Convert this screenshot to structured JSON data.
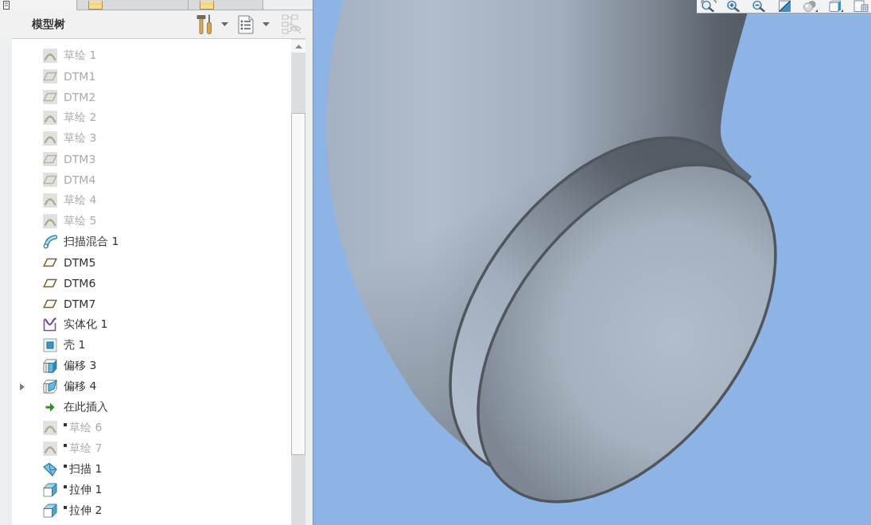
{
  "panel_tabs": [
    {
      "kind": "tree",
      "selected": true
    },
    {
      "kind": "folder",
      "selected": false
    },
    {
      "kind": "folder",
      "selected": false
    }
  ],
  "model_tree": {
    "title": "模型树",
    "toolbar": [
      {
        "kind": "tools",
        "dropdown": true,
        "disabled": false
      },
      {
        "kind": "display",
        "dropdown": true,
        "disabled": false
      },
      {
        "kind": "filter",
        "dropdown": false,
        "disabled": true
      }
    ],
    "items": [
      {
        "label": "草绘 1",
        "kind": "sketch",
        "hidden": true,
        "after_insert": false
      },
      {
        "label": "DTM1",
        "kind": "plane",
        "hidden": true,
        "after_insert": false
      },
      {
        "label": "DTM2",
        "kind": "plane",
        "hidden": true,
        "after_insert": false
      },
      {
        "label": "草绘 2",
        "kind": "sketch",
        "hidden": true,
        "after_insert": false
      },
      {
        "label": "草绘 3",
        "kind": "sketch",
        "hidden": true,
        "after_insert": false
      },
      {
        "label": "DTM3",
        "kind": "plane",
        "hidden": true,
        "after_insert": false
      },
      {
        "label": "DTM4",
        "kind": "plane",
        "hidden": true,
        "after_insert": false
      },
      {
        "label": "草绘 4",
        "kind": "sketch",
        "hidden": true,
        "after_insert": false
      },
      {
        "label": "草绘 5",
        "kind": "sketch",
        "hidden": true,
        "after_insert": false
      },
      {
        "label": "扫描混合 1",
        "kind": "sweep_blend",
        "hidden": false,
        "after_insert": false
      },
      {
        "label": "DTM5",
        "kind": "plane",
        "hidden": false,
        "after_insert": false
      },
      {
        "label": "DTM6",
        "kind": "plane",
        "hidden": false,
        "after_insert": false
      },
      {
        "label": "DTM7",
        "kind": "plane",
        "hidden": false,
        "after_insert": false
      },
      {
        "label": "实体化 1",
        "kind": "solidify",
        "hidden": false,
        "after_insert": false
      },
      {
        "label": "壳 1",
        "kind": "shell",
        "hidden": false,
        "after_insert": false
      },
      {
        "label": "偏移 3",
        "kind": "offset_solid",
        "hidden": false,
        "after_insert": false
      },
      {
        "label": "偏移 4",
        "kind": "offset_surface",
        "hidden": false,
        "after_insert": false,
        "expanded": false
      },
      {
        "label": "在此插入",
        "kind": "insert",
        "hidden": false,
        "after_insert": false
      },
      {
        "label": "草绘 6",
        "kind": "sketch",
        "hidden": true,
        "after_insert": true
      },
      {
        "label": "草绘 7",
        "kind": "sketch",
        "hidden": true,
        "after_insert": true
      },
      {
        "label": "扫描 1",
        "kind": "sweep",
        "hidden": false,
        "after_insert": true
      },
      {
        "label": "拉伸 1",
        "kind": "extrude",
        "hidden": false,
        "after_insert": true
      },
      {
        "label": "拉伸 2",
        "kind": "extrude",
        "hidden": false,
        "after_insert": true
      }
    ]
  },
  "view_toolbar": [
    {
      "kind": "refit",
      "menu": false
    },
    {
      "kind": "zoom_in",
      "menu": false
    },
    {
      "kind": "zoom_out",
      "menu": false
    },
    {
      "kind": "repaint",
      "menu": false
    },
    {
      "kind": "shading",
      "menu": true
    },
    {
      "kind": "view",
      "menu": true
    },
    {
      "kind": "saved_views",
      "menu": false
    }
  ]
}
